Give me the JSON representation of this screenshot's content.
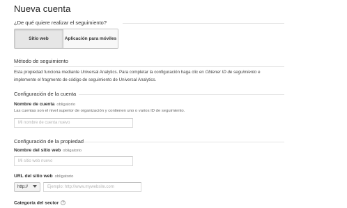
{
  "page": {
    "title": "Nueva cuenta"
  },
  "tracking_question": "¿De qué quiere realizar el seguimiento?",
  "tabs": [
    {
      "label": "Sitio web"
    },
    {
      "label": "Aplicación para móviles"
    }
  ],
  "tracking_method": {
    "title": "Método de seguimiento",
    "line1_before": "Esta propiedad funciona mediante Universal Analytics. Para completar la configuración haga clic en ",
    "line1_italic": "Obtener ID de seguimiento",
    "line1_after": " e",
    "line2": "implemente el fragmento de código de seguimiento de Universal Analytics."
  },
  "account_config": {
    "title": "Configuración de la cuenta",
    "account_name_label": "Nombre de cuenta",
    "required": "obligatorio",
    "help": "Las cuentas son el nivel superior de organización y contienen uno o varios ID de seguimiento.",
    "account_name_placeholder": "Mi nombre de cuenta nuevo"
  },
  "property_config": {
    "title": "Configuración de la propiedad",
    "site_name_label": "Nombre del sitio web",
    "required": "obligatorio",
    "site_name_placeholder": "Mi sitio web nuevo",
    "url_label": "URL del sitio web",
    "url_required": "obligatorio",
    "protocol": "http://",
    "url_placeholder": "Ejemplo: http://www.mywebsite.com",
    "category_label": "Categoría del sector",
    "help_icon_glyph": "?"
  },
  "icons": {
    "dropdown": "chevron-down-icon",
    "help": "help-icon"
  }
}
